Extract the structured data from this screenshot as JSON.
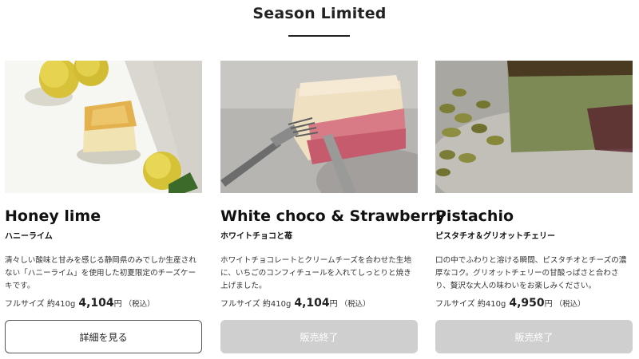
{
  "section": {
    "title": "Season Limited"
  },
  "products": [
    {
      "name_en": "Honey lime",
      "name_jp": "ハニーライム",
      "description": "清々しい酸味と甘みを感じる静岡県のみでしか生産されない「ハニーライム」を使用した初夏限定のチーズケーキです。",
      "size_label": "フルサイズ 約410g",
      "price": "4,104",
      "yen": "円",
      "tax": "（税込）",
      "button_label": "詳細を見る",
      "button_state": "active"
    },
    {
      "name_en": "White choco & Strawberry",
      "name_jp": "ホワイトチョコと苺",
      "description": "ホワイトチョコレートとクリームチーズを合わせた生地に、いちごのコンフィチュールを入れてしっとりと焼き上げました。",
      "size_label": "フルサイズ 約410g",
      "price": "4,104",
      "yen": "円",
      "tax": "（税込）",
      "button_label": "販売終了",
      "button_state": "disabled"
    },
    {
      "name_en": "Pistachio",
      "name_jp": "ピスタチオ＆グリオットチェリー",
      "description": "口の中でふわりと溶ける瞬間、ピスタチオとチーズの濃厚なコク。グリオットチェリーの甘酸っぱさと合わさり、贅沢な大人の味わいをお楽しみください。",
      "size_label": "フルサイズ 約410g",
      "price": "4,950",
      "yen": "円",
      "tax": "（税込）",
      "button_label": "販売終了",
      "button_state": "disabled"
    }
  ],
  "colors": {
    "button_disabled_bg": "#cfcfcf",
    "button_active_border": "#555555"
  }
}
